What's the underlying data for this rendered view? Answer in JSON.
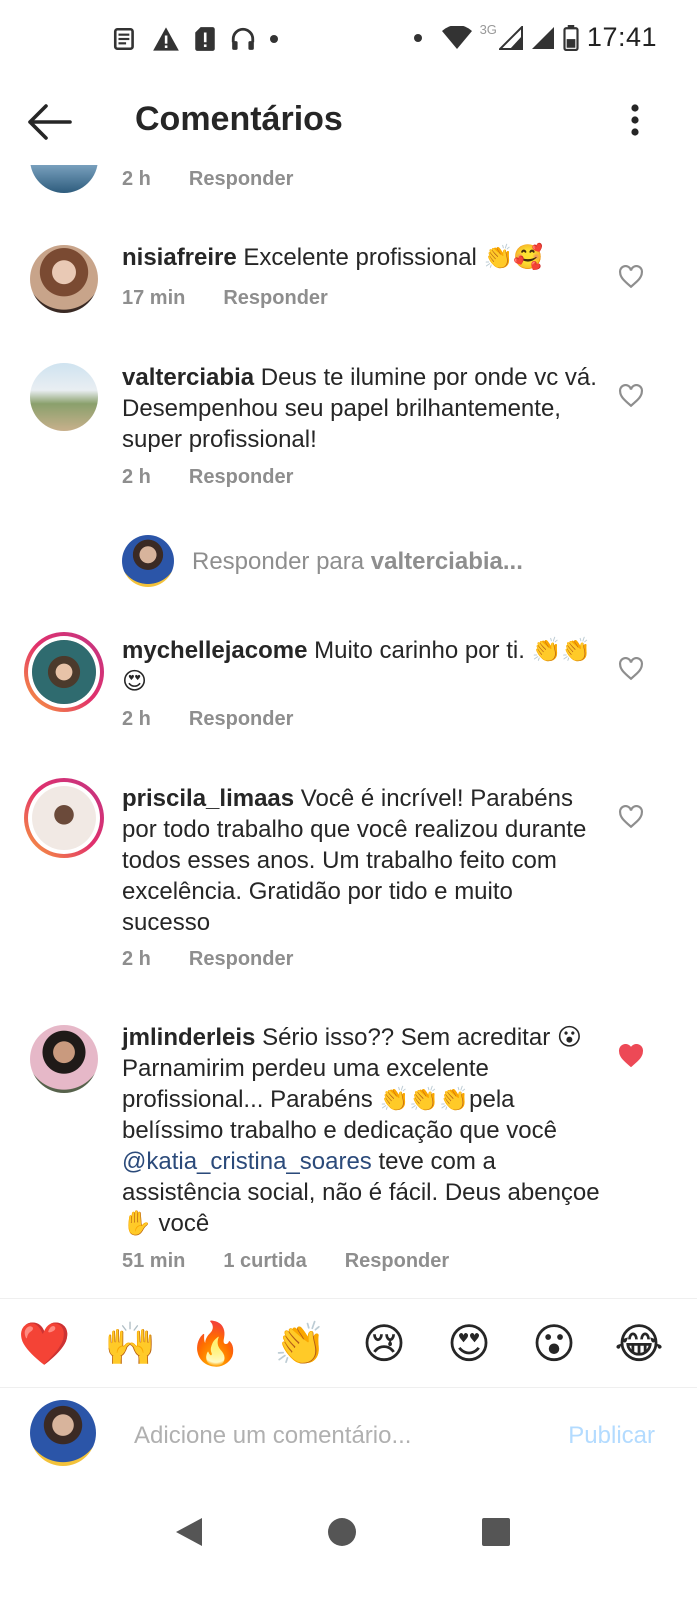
{
  "status_bar": {
    "time": "17:41",
    "network_label": "3G",
    "icons": [
      "news-icon",
      "warning-icon",
      "sim-alert-icon",
      "headphones-icon",
      "dot-icon",
      "dot-icon",
      "wifi-icon",
      "signal-icon",
      "signal-icon",
      "battery-icon"
    ]
  },
  "header": {
    "title": "Comentários",
    "back_icon": "arrow-left-icon",
    "more_icon": "more-vertical-icon"
  },
  "comments": [
    {
      "username": "",
      "text": "",
      "time": "2 h",
      "likes": "",
      "reply_label": "Responder",
      "liked": false
    },
    {
      "username": "nisiafreire",
      "text": "Excelente profissional 👏🥰",
      "time": "17 min",
      "likes": "",
      "reply_label": "Responder",
      "liked": false
    },
    {
      "username": "valterciabia",
      "text": "Deus te ilumine por onde vc vá. Desempenhou seu papel brilhantemente, super profissional!",
      "time": "2 h",
      "likes": "",
      "reply_label": "Responder",
      "liked": false
    },
    {
      "username": "mychellejacome",
      "text": "Muito carinho por ti. 👏👏😍",
      "time": "2 h",
      "likes": "",
      "reply_label": "Responder",
      "liked": false
    },
    {
      "username": "priscila_limaas",
      "text": "Você é incrível! Parabéns por todo trabalho que você realizou durante todos esses anos. Um trabalho feito com excelência. Gratidão por tido e muito sucesso",
      "time": "2 h",
      "likes": "",
      "reply_label": "Responder",
      "liked": false
    },
    {
      "username": "jmlinderleis",
      "text_before": "Sério isso?? Sem acreditar 😮 Parnamirim perdeu uma excelente profissional... Parabéns 👏👏👏pela belíssimo trabalho e dedicação que você ",
      "mention": "@katia_cristina_soares",
      "text_after": "  teve com a assistência social, não é fácil. Deus abençoe ✋ você",
      "time": "51 min",
      "likes": "1 curtida",
      "reply_label": "Responder",
      "liked": true
    }
  ],
  "reply_prompt": {
    "prefix": "Responder para ",
    "username": "valterciabia..."
  },
  "emoji_bar": [
    "❤️",
    "🙌",
    "🔥",
    "👏",
    "😢",
    "😍",
    "😮",
    "😂"
  ],
  "composer": {
    "placeholder": "Adicione um comentário...",
    "publish_label": "Publicar"
  },
  "nav": [
    "back-triangle-icon",
    "home-circle-icon",
    "recents-square-icon"
  ],
  "colors": {
    "text": "#262626",
    "meta": "#8e8e8e",
    "liked_heart": "#ed4956",
    "publish_disabled": "#b3dbff",
    "mention": "#2b4a7a"
  }
}
